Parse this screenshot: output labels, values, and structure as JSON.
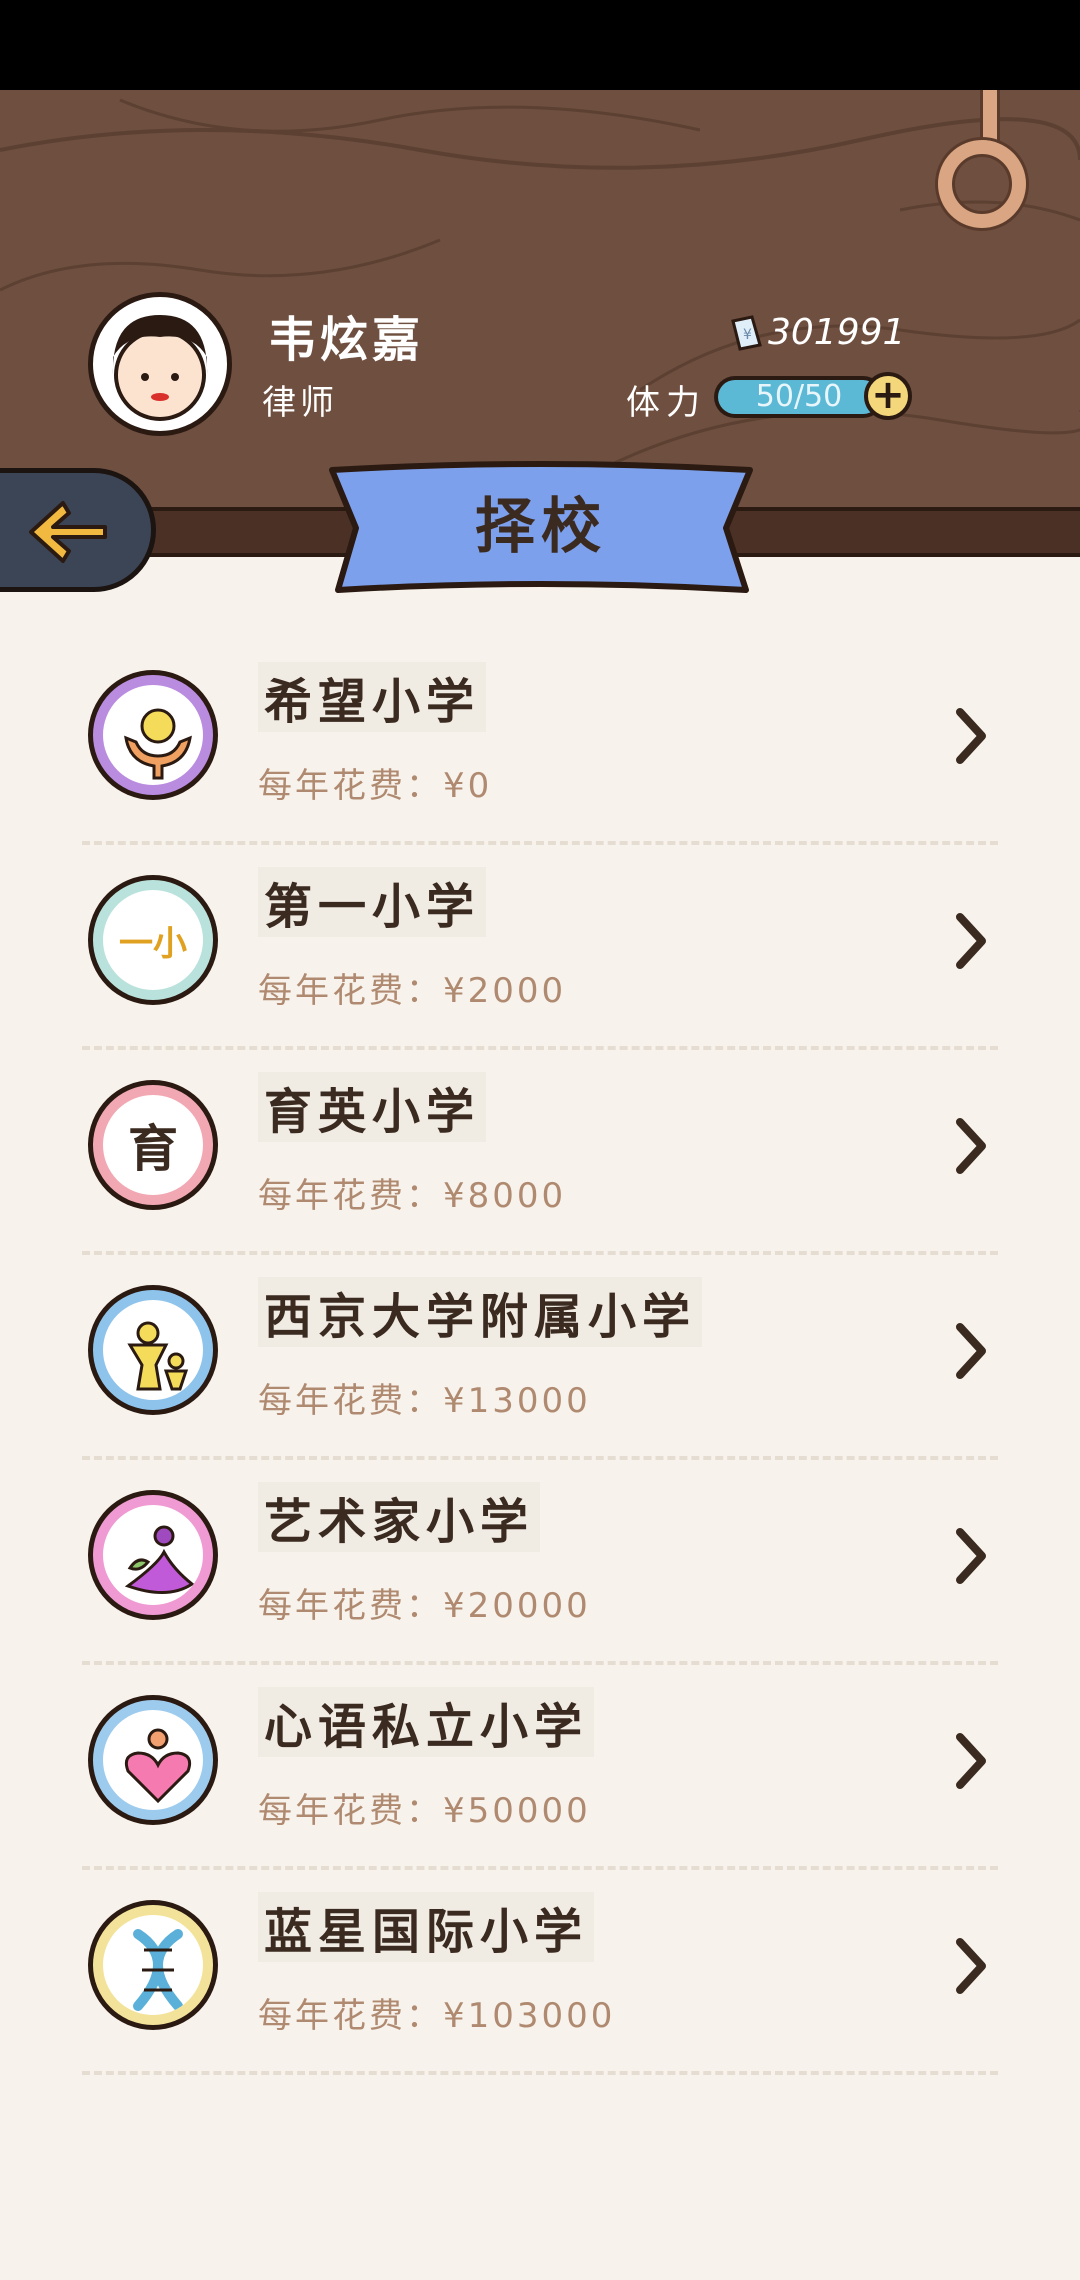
{
  "player": {
    "name": "韦炫嘉",
    "job": "律师",
    "money": "301991",
    "stamina_label": "体力",
    "stamina_value": "50/50",
    "stamina_fraction": 1.0,
    "plus_label": "+"
  },
  "banner": {
    "title": "择校"
  },
  "fee_prefix": "每年花费：¥",
  "schools": [
    {
      "name": "希望小学",
      "fee": "0",
      "icon": "hope-hands-icon",
      "ring_color": "#b98ce0"
    },
    {
      "name": "第一小学",
      "fee": "2000",
      "icon": "first-school-text-icon",
      "ring_color": "#b9e2dc",
      "icon_text": "一小"
    },
    {
      "name": "育英小学",
      "fee": "8000",
      "icon": "yuying-text-icon",
      "ring_color": "#f2a8b2",
      "icon_text": "育"
    },
    {
      "name": "西京大学附属小学",
      "fee": "13000",
      "icon": "parent-child-icon",
      "ring_color": "#8ec3ec"
    },
    {
      "name": "艺术家小学",
      "fee": "20000",
      "icon": "artist-figure-icon",
      "ring_color": "#ef9ad2"
    },
    {
      "name": "心语私立小学",
      "fee": "50000",
      "icon": "heart-person-icon",
      "ring_color": "#9dcbee"
    },
    {
      "name": "蓝星国际小学",
      "fee": "103000",
      "icon": "dna-icon",
      "ring_color": "#f3e39a"
    }
  ]
}
